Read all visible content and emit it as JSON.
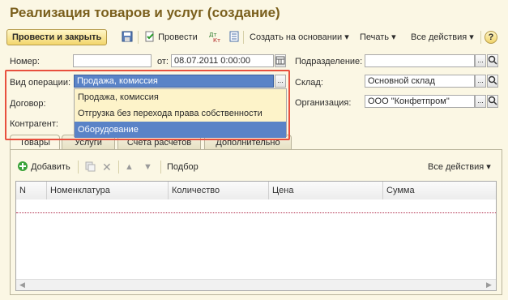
{
  "window": {
    "title": "Реализация товаров и услуг (создание)"
  },
  "toolbar": {
    "post_and_close": "Провести и закрыть",
    "post": "Провести",
    "create_based_on": "Создать на основании",
    "print": "Печать",
    "all_actions": "Все действия",
    "help": "?"
  },
  "form": {
    "number_label": "Номер:",
    "number_value": "",
    "date_from_label": "от:",
    "date_value": "08.07.2011  0:00:00",
    "division_label": "Подразделение:",
    "division_value": "",
    "operation_label": "Вид операции:",
    "operation_value": "Продажа, комиссия",
    "warehouse_label": "Склад:",
    "warehouse_value": "Основной склад",
    "contract_label": "Договор:",
    "organization_label": "Организация:",
    "organization_value": "ООО \"Конфетпром\"",
    "counterparty_label": "Контрагент:"
  },
  "dropdown": {
    "options": [
      "Продажа, комиссия",
      "Отгрузка без перехода права собственности",
      "Оборудование"
    ],
    "selected_index": 2
  },
  "tabs": [
    "Товары",
    "Услуги",
    "Счета расчетов",
    "Дополнительно"
  ],
  "table_toolbar": {
    "add": "Добавить",
    "selection": "Подбор",
    "all_actions": "Все действия"
  },
  "table": {
    "columns": [
      "N",
      "Номенклатура",
      "Количество",
      "Цена",
      "Сумма"
    ]
  },
  "colors": {
    "title": "#7a5f1c",
    "highlight": "#5a83c7",
    "annotation": "#e8503e"
  }
}
